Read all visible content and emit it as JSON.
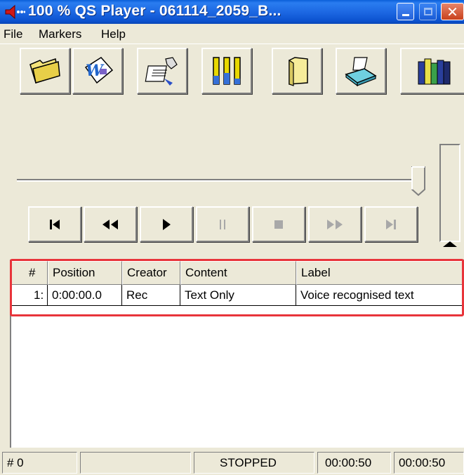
{
  "window": {
    "title": "100 % QS Player - 061114_2059_B...",
    "icons": [
      "app-speaker-icon",
      "minimize-icon",
      "maximize-icon",
      "close-icon"
    ],
    "close_glyph": "✕"
  },
  "menu": {
    "items": [
      "File",
      "Markers",
      "Help"
    ]
  },
  "toolbar": {
    "buttons": [
      {
        "icon": "open-folder-icon"
      },
      {
        "icon": "word-document-icon"
      },
      {
        "icon": "dictation-hand-icon"
      },
      {
        "icon": "level-meters-icon"
      },
      {
        "icon": "yellow-folder-icon"
      },
      {
        "icon": "tray-icon"
      },
      {
        "icon": "books-icon"
      }
    ]
  },
  "transport": {
    "buttons": [
      "skip-to-start-icon",
      "rewind-icon",
      "play-icon",
      "pause-icon",
      "stop-icon",
      "fast-forward-icon",
      "skip-to-end-icon"
    ],
    "position_fraction": 1.0
  },
  "table": {
    "columns": [
      "#",
      "Position",
      "Creator",
      "Content",
      "Label"
    ],
    "rows": [
      [
        "1:",
        "0:00:00.0",
        "Rec",
        "Text Only",
        "Voice recognised text"
      ]
    ]
  },
  "status": {
    "marker": "# 0",
    "blank": "",
    "state": "STOPPED",
    "time1": "00:00:50",
    "time2": "00:00:50"
  },
  "colors": {
    "highlight": "#e8343a",
    "titlebar": "#1d68e3"
  }
}
